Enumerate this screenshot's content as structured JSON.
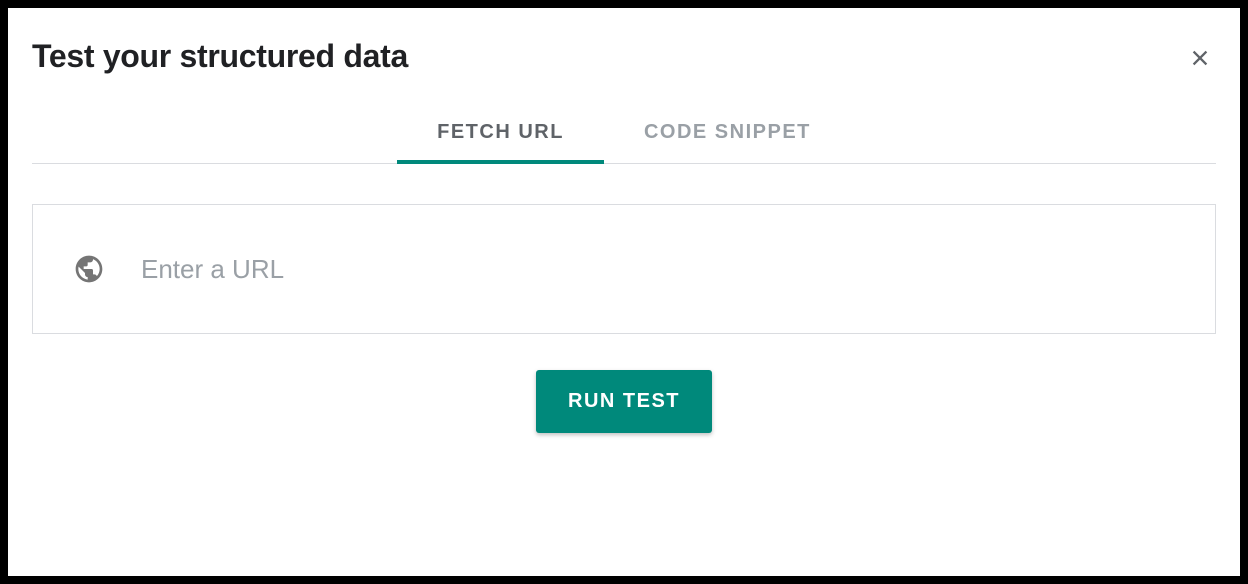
{
  "header": {
    "title": "Test your structured data"
  },
  "tabs": {
    "fetch_url": "FETCH URL",
    "code_snippet": "CODE SNIPPET"
  },
  "input": {
    "placeholder": "Enter a URL",
    "value": ""
  },
  "buttons": {
    "run_test": "RUN TEST"
  }
}
